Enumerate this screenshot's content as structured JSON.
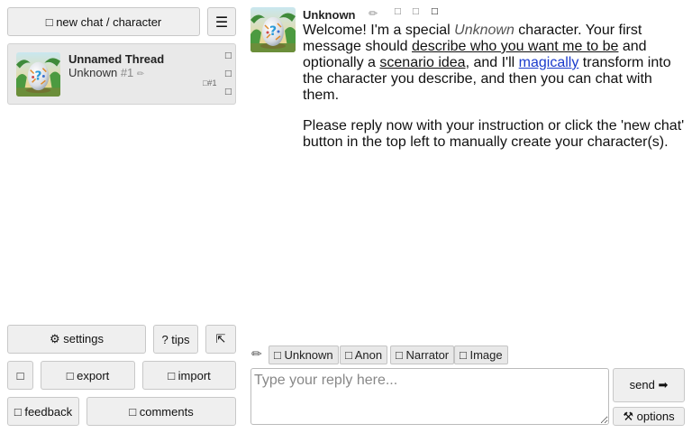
{
  "sidebar": {
    "new_chat_label": "□ new chat / character",
    "menu_icon": "☰",
    "thread": {
      "title": "Unnamed Thread",
      "character": "Unknown",
      "number": "#1",
      "edit_icon": "✏",
      "count": "□#1",
      "icon_top": "□",
      "icon_mid": "□",
      "icon_bottom": "□"
    },
    "settings_label": "⚙ settings",
    "tips_label": "? tips",
    "collapse_icon": "⇱",
    "theme_label": "□",
    "export_label": "□ export",
    "import_label": "□ import",
    "feedback_label": "□ feedback",
    "comments_label": "□ comments"
  },
  "message": {
    "author": "Unknown",
    "edit_icon": "✏",
    "icon2": "□",
    "icon3": "□",
    "icon4": "□",
    "p1_a": "Welcome! I'm a special ",
    "p1_b": "Unknown",
    "p1_c": " character. Your first message should ",
    "p1_d": "describe who you want me to be",
    "p1_e": " and optionally a ",
    "p1_f": "scenario idea",
    "p1_g": ", and I'll ",
    "p1_h": "magically",
    "p1_i": " transform into the character you describe, and then you can chat with them.",
    "p2": "Please reply now with your instruction or click the 'new chat' button in the top left to manually create your character(s)."
  },
  "reply": {
    "pencil_icon": "✏",
    "chips": [
      "□ Unknown",
      "□ Anon",
      "□ Narrator",
      "□ Image"
    ],
    "placeholder": "Type your reply here...",
    "value": "",
    "send_label": "send ➡",
    "options_label": "⚒ options"
  },
  "colors": {
    "link": "#1a3bcc",
    "button_bg": "#efefef",
    "card_bg": "#e9e9e9"
  },
  "icons": {
    "avatar": "egg-avatar-icon"
  }
}
